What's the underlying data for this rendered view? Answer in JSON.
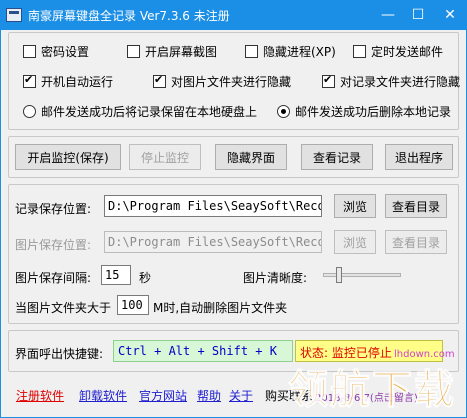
{
  "window": {
    "title": "南豪屏幕键盘全记录   Ver7.3.6   未注册"
  },
  "options": {
    "password": "密码设置",
    "screenshot": "开启屏幕截图",
    "hide_process": "隐藏进程(XP)",
    "scheduled_mail": "定时发送邮件",
    "autostart": "开机自动运行",
    "hide_image_folder": "对图片文件夹进行隐藏",
    "hide_record_folder": "对记录文件夹进行隐藏",
    "radio_keep": "邮件发送成功后将记录保留在本地硬盘上",
    "radio_delete": "邮件发送成功后删除本地记录"
  },
  "buttons": {
    "start": "开启监控(保存)",
    "stop": "停止监控",
    "hide": "隐藏界面",
    "view": "查看记录",
    "exit": "退出程序",
    "browse": "浏览",
    "view_dir": "查看目录"
  },
  "paths": {
    "record_label": "记录保存位置:",
    "record_value": "D:\\Program Files\\SeaySoft\\Record",
    "image_label": "图片保存位置:",
    "image_value": "D:\\Program Files\\SeaySoft\\Record"
  },
  "image_settings": {
    "interval_label": "图片保存间隔:",
    "interval_value": "15",
    "interval_unit": "秒",
    "clarity_label": "图片清晰度:",
    "clarity_level": 0.18,
    "folder_prefix": "当图片文件夹大于",
    "folder_size": "100",
    "folder_suffix": "M时,自动删除图片文件夹"
  },
  "hotkey": {
    "label": "界面呼出快捷键:",
    "value": "Ctrl + Alt + Shift + K",
    "status": "状态: 监控已停止"
  },
  "footer": {
    "register": "注册软件",
    "uninstall": "卸载软件",
    "website": "官方网站",
    "help": "帮助",
    "about": "关于",
    "purchase": "购买联系",
    "version_note": "2018-8-6 7(点击留言)"
  },
  "watermark": {
    "text": "领航下载",
    "site": "lhdown.com"
  },
  "colors": {
    "titlebar": "#1b8ee6",
    "hotkey_bg": "#d7f7d7",
    "status_bg": "#ffff88",
    "status_text": "#e00000"
  }
}
